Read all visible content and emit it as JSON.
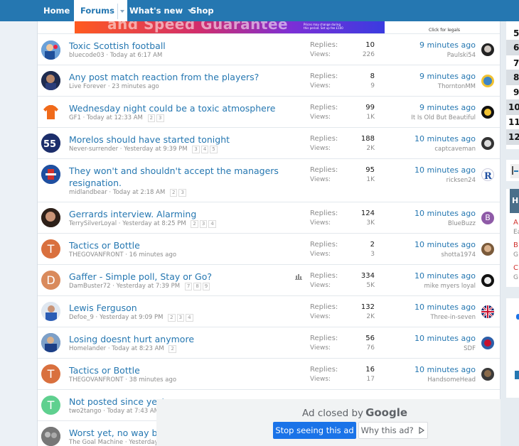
{
  "nav": {
    "items": [
      {
        "label": "Home"
      },
      {
        "label": "Forums"
      },
      {
        "label": "What's new"
      },
      {
        "label": "Shop"
      }
    ]
  },
  "ad_top": {
    "slogan": "and Speed Guarantee",
    "fine": "Prices may change during this period. Set up fee £100",
    "click": "Click for legals"
  },
  "threads": [
    {
      "title": "Toxic Scottish football",
      "author": "bluecode03",
      "date": "Today at 6:17 AM",
      "pages": [],
      "replies": "10",
      "views": "226",
      "last_time": "9 minutes ago",
      "last_user": "Paulski54"
    },
    {
      "title": "Any post match reaction from the players?",
      "author": "Live Forever",
      "date": "23 minutes ago",
      "pages": [],
      "replies": "8",
      "views": "9",
      "last_time": "9 minutes ago",
      "last_user": "ThorntonMM"
    },
    {
      "title": "Wednesday night could be a toxic atmosphere",
      "author": "GF1",
      "date": "Today at 12:33 AM",
      "pages": [
        "2",
        "3"
      ],
      "replies": "99",
      "views": "1K",
      "last_time": "9 minutes ago",
      "last_user": "It Is Old But Beautiful"
    },
    {
      "title": "Morelos should have started tonight",
      "author": "Never-surrender",
      "date": "Yesterday at 9:39 PM",
      "pages": [
        "3",
        "4",
        "5"
      ],
      "replies": "188",
      "views": "2K",
      "last_time": "10 minutes ago",
      "last_user": "captcaveman"
    },
    {
      "title": "They won't and shouldn't accept the managers",
      "title2": "resignation.",
      "author": "midlandbear",
      "date": "Today at 2:18 AM",
      "pages": [
        "2",
        "3"
      ],
      "replies": "95",
      "views": "1K",
      "last_time": "10 minutes ago",
      "last_user": "ricksen24"
    },
    {
      "title": "Gerrards interview. Alarming",
      "author": "TerrySilverLoyal",
      "date": "Yesterday at 8:25 PM",
      "pages": [
        "2",
        "3",
        "4"
      ],
      "replies": "124",
      "views": "3K",
      "last_time": "10 minutes ago",
      "last_user": "BlueBuzz"
    },
    {
      "title": "Tactics or Bottle",
      "author": "THEGOVANFRONT",
      "date": "16 minutes ago",
      "pages": [],
      "replies": "2",
      "views": "3",
      "last_time": "10 minutes ago",
      "last_user": "shotta1974"
    },
    {
      "title": "Gaffer - Simple poll, Stay or Go?",
      "author": "DamBuster72",
      "date": "Yesterday at 7:39 PM",
      "pages": [
        "7",
        "8",
        "9"
      ],
      "replies": "334",
      "views": "5K",
      "last_time": "10 minutes ago",
      "last_user": "mike myers loyal"
    },
    {
      "title": "Lewis Ferguson",
      "author": "Defoe_9",
      "date": "Yesterday at 9:09 PM",
      "pages": [
        "2",
        "3",
        "4"
      ],
      "replies": "132",
      "views": "2K",
      "last_time": "10 minutes ago",
      "last_user": "Three-in-seven"
    },
    {
      "title": "Losing doesnt hurt anymore",
      "author": "Homelander",
      "date": "Today at 8:23 AM",
      "pages": [
        "2"
      ],
      "replies": "56",
      "views": "76",
      "last_time": "10 minutes ago",
      "last_user": "SDF"
    },
    {
      "title": "Tactics or Bottle",
      "author": "THEGOVANFRONT",
      "date": "38 minutes ago",
      "pages": [],
      "replies": "16",
      "views": "17",
      "last_time": "10 minutes ago",
      "last_user": "HandsomeHead"
    },
    {
      "title": "Not posted since yeste",
      "author": "two2tango",
      "date": "Today at 7:43 AM",
      "pages": []
    },
    {
      "title": "Worst yet, no way bac",
      "author": "The Goal Machine",
      "date": "Yesterday a",
      "pages": []
    }
  ],
  "labels": {
    "replies": "Replies:",
    "views": "Views:"
  },
  "avatar_letters": {
    "t1": "T",
    "t2": "D",
    "t3": "T",
    "t4": "T"
  },
  "sidebar_nums": [
    "5",
    "6",
    "7",
    "8",
    "9",
    "10",
    "11",
    "12"
  ],
  "sidebar_letters": [
    "A",
    "B",
    "C"
  ],
  "sidebar_misc": {
    "h": "H",
    "ea": "Ea",
    "g1": "G",
    "g2": "G"
  },
  "google_ad": {
    "closed_by": "Ad closed by",
    "google": "Google",
    "stop": "Stop seeing this ad",
    "why": "Why this ad?"
  }
}
